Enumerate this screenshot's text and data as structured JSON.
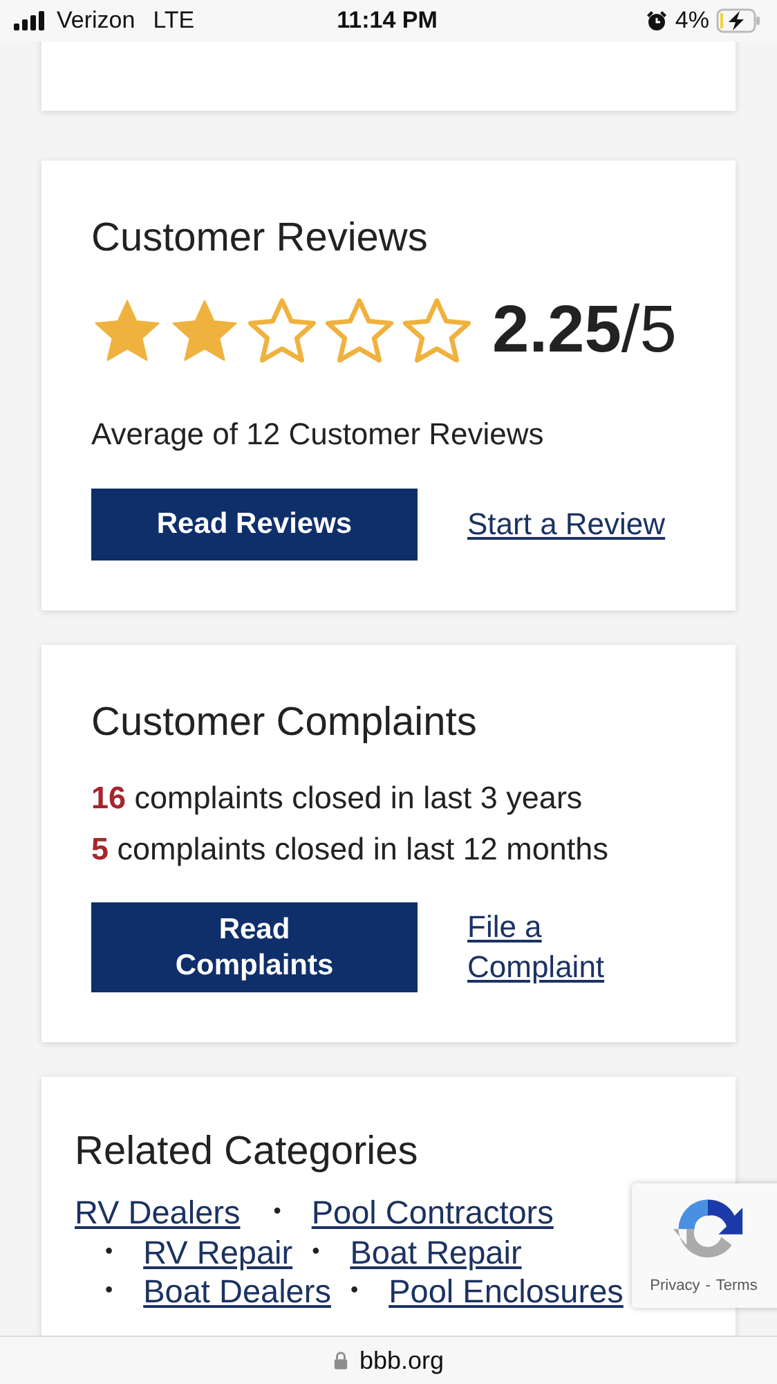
{
  "status_bar": {
    "carrier": "Verizon",
    "network": "LTE",
    "time": "11:14 PM",
    "battery": "4%"
  },
  "reviews": {
    "title": "Customer Reviews",
    "stars": 2,
    "score": "2.25",
    "out_of": "/5",
    "summary": "Average of 12 Customer Reviews",
    "button": "Read Reviews",
    "link": "Start a Review"
  },
  "complaints": {
    "title": "Customer Complaints",
    "lines": [
      {
        "count": "16",
        "text": "complaints closed in last 3 years"
      },
      {
        "count": "5",
        "text": "complaints closed in last 12 months"
      }
    ],
    "button": "Read Complaints",
    "link": "File a Complaint"
  },
  "related": {
    "title": "Related Categories",
    "lines": [
      [
        {
          "label": "RV Dealers"
        },
        {
          "bullet": "•",
          "label": "Pool Contractors"
        }
      ],
      [
        {
          "bullet": "•",
          "label": "RV Repair"
        },
        {
          "bullet": "•",
          "label": "Boat Repair"
        }
      ],
      [
        {
          "bullet": "•",
          "label": "Boat Dealers"
        },
        {
          "bullet": "•",
          "label": "Pool Enclosures"
        }
      ]
    ]
  },
  "recaptcha": {
    "privacy": "Privacy",
    "separator": "-",
    "terms": "Terms"
  },
  "url_bar": {
    "domain": "bbb.org"
  }
}
